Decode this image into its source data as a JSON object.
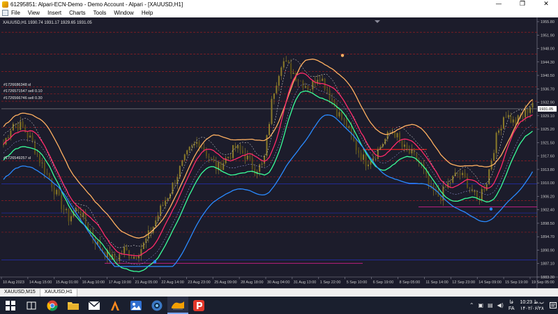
{
  "window": {
    "title": "61295851: Alpari-ECN-Demo - Demo Account - Alpari - [XAUUSD,H1]",
    "controls": [
      "—",
      "❐",
      "✕"
    ]
  },
  "menu": {
    "items": [
      "File",
      "View",
      "Insert",
      "Charts",
      "Tools",
      "Window",
      "Help"
    ],
    "mdi_controls": [
      "—",
      "❐",
      "✕"
    ]
  },
  "chart": {
    "header": "XAUUSD,H1  1930.74 1931.17 1929.65 1931.05",
    "current_price": "1931.05",
    "order_labels": [
      "#1726686348 sl",
      "#1726571547 sell 0.10",
      "#1726566746 sell 0.30",
      "#1726549257 sl"
    ],
    "colors": {
      "background": "#1c1c2b",
      "candle": "#8a7a2a",
      "upper_band": "#ffb061",
      "middle_line": "#ff2a6a",
      "lower_band": "#3aff9a",
      "support_line": "#2a8aff",
      "order_line": "#c81e1e",
      "grid": "#3a3a52"
    }
  },
  "chart_data": {
    "type": "candlestick",
    "symbol": "XAUUSD",
    "timeframe": "H1",
    "y_ticks": [
      "1955.80",
      "1951.90",
      "1948.00",
      "1944.30",
      "1940.50",
      "1936.70",
      "1932.90",
      "1929.10",
      "1925.20",
      "1921.50",
      "1917.60",
      "1913.80",
      "1910.00",
      "1906.20",
      "1902.40",
      "1898.50",
      "1894.70",
      "1890.90",
      "1887.10",
      "1883.30"
    ],
    "x_ticks": [
      "10 Aug 2023",
      "14 Aug 15:00",
      "15 Aug 01:00",
      "16 Aug 10:00",
      "17 Aug 19:00",
      "21 Aug 05:00",
      "22 Aug 14:00",
      "23 Aug 23:00",
      "25 Aug 09:00",
      "28 Aug 18:00",
      "30 Aug 04:00",
      "31 Aug 13:00",
      "1 Sep 22:00",
      "5 Sep 10:00",
      "6 Sep 19:00",
      "8 Sep 05:00",
      "11 Sep 14:00",
      "12 Sep 23:00",
      "14 Sep 09:00",
      "15 Sep 19:00",
      "19 Sep 05:00"
    ],
    "ylim": [
      1883.3,
      1955.8
    ],
    "price_path": [
      1921,
      1927,
      1926,
      1922,
      1916,
      1911,
      1905,
      1900,
      1903,
      1898,
      1893,
      1890,
      1888,
      1891,
      1889,
      1892,
      1897,
      1903,
      1908,
      1914,
      1919,
      1922,
      1918,
      1914,
      1917,
      1920,
      1918,
      1914,
      1915,
      1935,
      1945,
      1942,
      1939,
      1937,
      1941,
      1936,
      1930,
      1926,
      1920,
      1916,
      1918,
      1922,
      1925,
      1920,
      1918,
      1915,
      1908,
      1906,
      1910,
      1913,
      1910,
      1905,
      1910,
      1922,
      1930,
      1927,
      1929,
      1933
    ]
  },
  "tabs": [
    "XAUUSD,M15",
    "XAUUSD,H1"
  ],
  "taskbar": {
    "language": "FA",
    "lang_sup": "فا",
    "time": "10:23 ب.ظ",
    "date": "۱۴۰۲/۰۶/۲۸"
  }
}
